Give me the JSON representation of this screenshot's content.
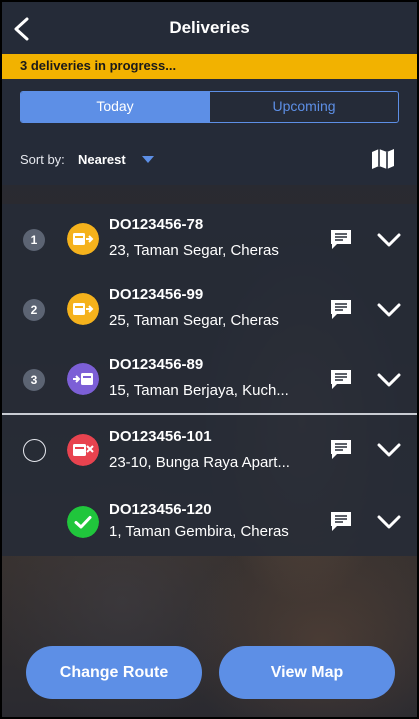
{
  "header": {
    "title": "Deliveries",
    "back_icon": "chevron-left-icon"
  },
  "banner": {
    "text": "3 deliveries in progress..."
  },
  "tabs": [
    {
      "label": "Today",
      "active": true
    },
    {
      "label": "Upcoming",
      "active": false
    }
  ],
  "sort": {
    "label": "Sort by:",
    "value": "Nearest",
    "map_icon": "map-icon"
  },
  "deliveries": [
    {
      "seq": "1",
      "id": "DO123456-78",
      "address": "23, Taman Segar, Cheras",
      "status": "in-transit",
      "status_icon": "truck-out-icon",
      "status_color": "#f5b21c"
    },
    {
      "seq": "2",
      "id": "DO123456-99",
      "address": "25, Taman Segar, Cheras",
      "status": "in-transit",
      "status_icon": "truck-out-icon",
      "status_color": "#f5b21c"
    },
    {
      "seq": "3",
      "id": "DO123456-89",
      "address": "15, Taman Berjaya, Kuch...",
      "status": "arriving",
      "status_icon": "truck-in-icon",
      "status_color": "#7c5fd6"
    },
    {
      "seq": "",
      "id": "DO123456-101",
      "address": "23-10, Bunga Raya Apart...",
      "status": "failed",
      "status_icon": "failed-delivery-icon",
      "status_color": "#e8434f"
    },
    {
      "seq": "",
      "id": "DO123456-120",
      "address": "1, Taman Gembira, Cheras",
      "status": "completed",
      "status_icon": "check-icon",
      "status_color": "#20c63c"
    }
  ],
  "colors": {
    "accent": "#5d8fe6",
    "banner": "#f2b200",
    "header": "#252b38"
  },
  "actions": {
    "change_route": "Change Route",
    "view_map": "View Map"
  }
}
